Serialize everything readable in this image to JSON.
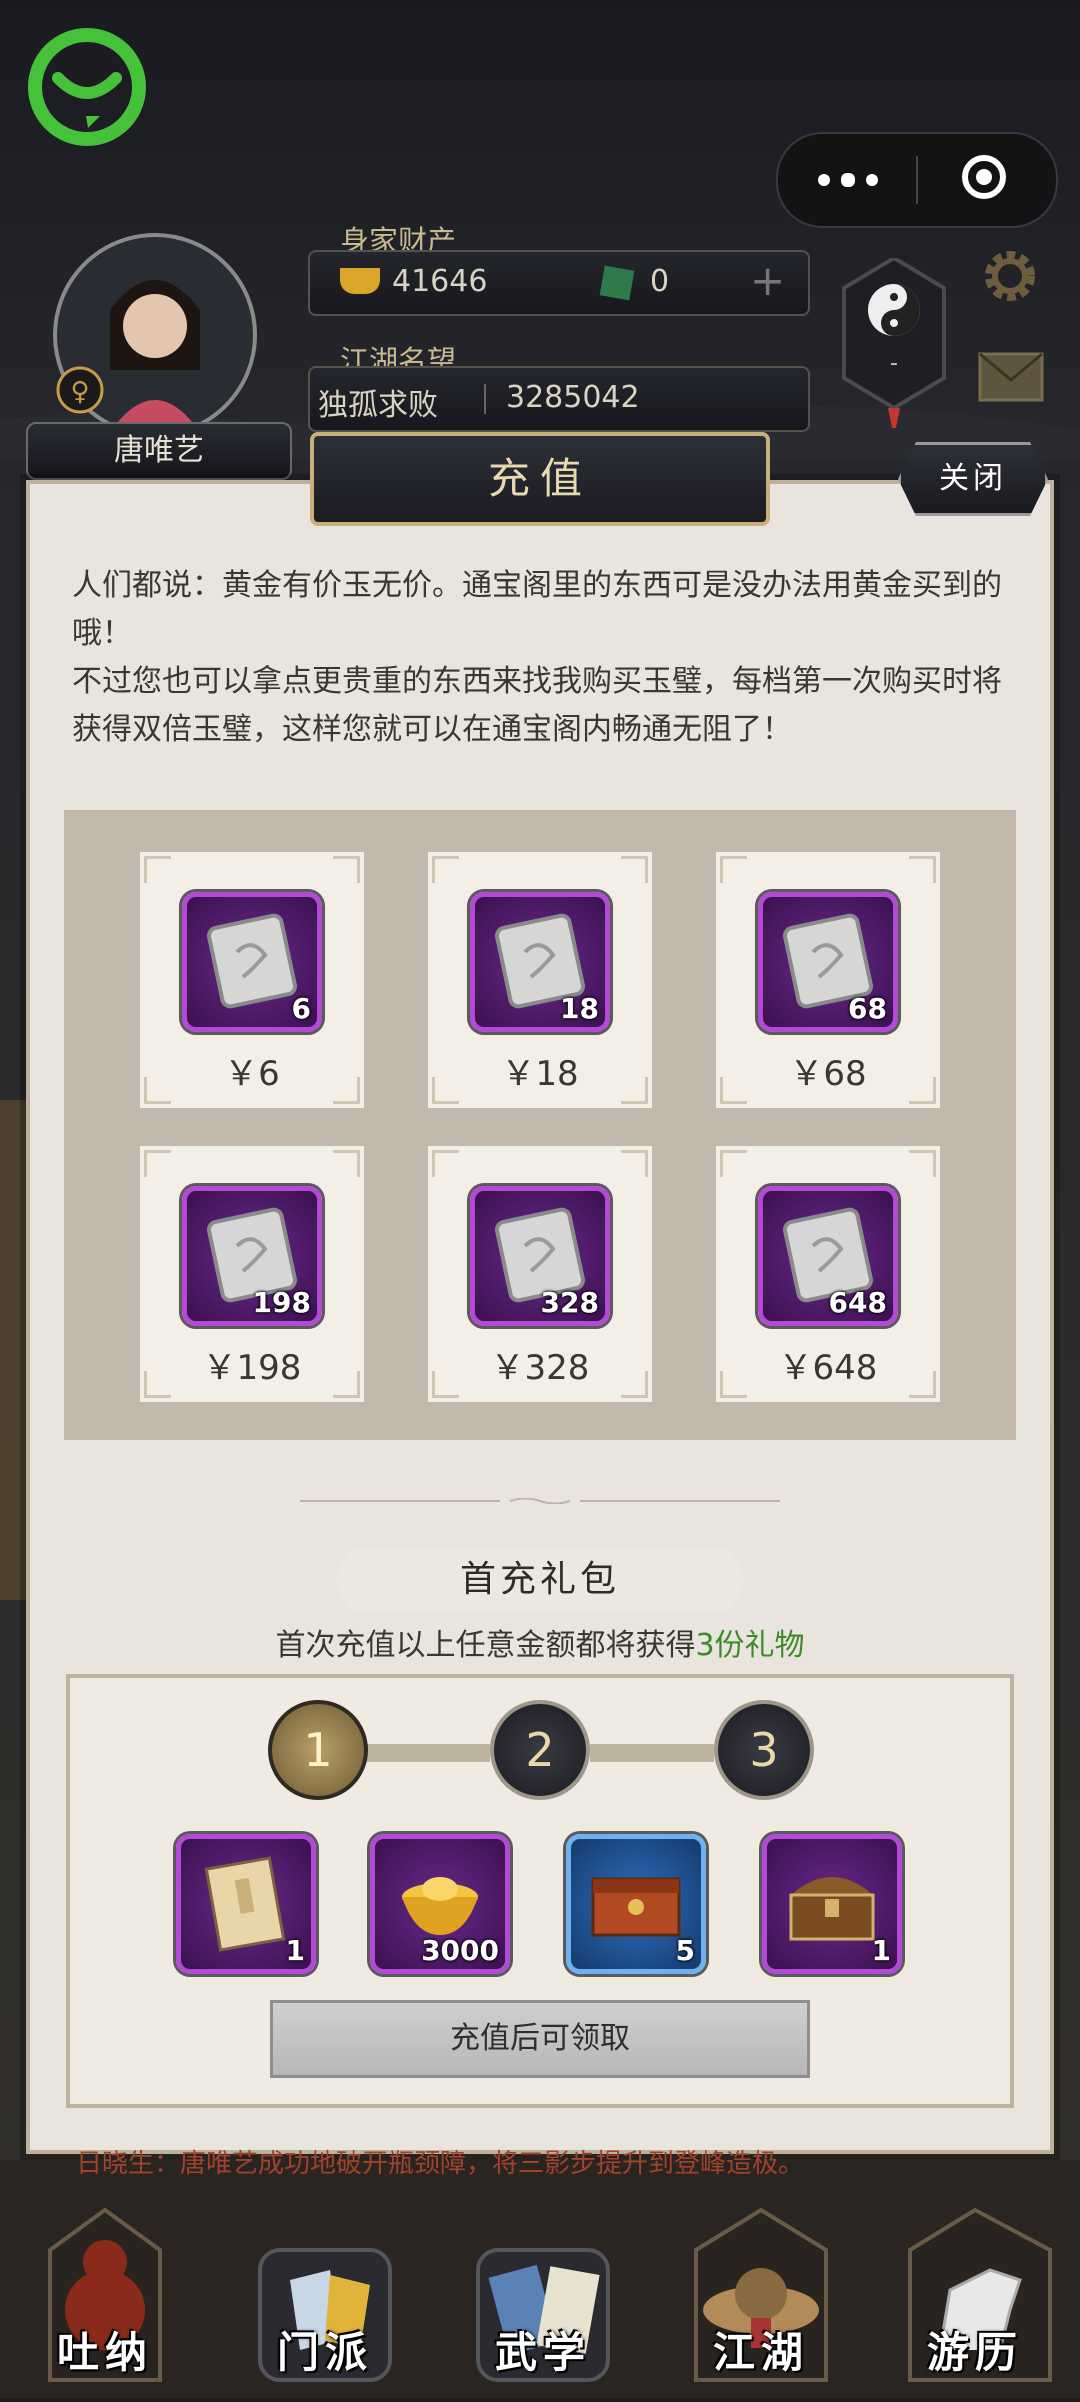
{
  "header": {
    "wealth_label": "身家财产",
    "gold": "41646",
    "jade": "0",
    "fame_label": "江湖名望",
    "title": "独孤求败",
    "fame_value": "3285042",
    "player_name": "唐唯艺",
    "taiji_value": "-"
  },
  "dialog": {
    "title": "充值",
    "close_label": "关闭",
    "intro": "人们都说：黄金有价玉无价。通宝阁里的东西可是没办法用黄金买到的哦！\n不过您也可以拿点更贵重的东西来找我购买玉璧，每档第一次购买时将获得双倍玉璧，这样您就可以在通宝阁内畅通无阻了！",
    "packs": [
      {
        "qty": "6",
        "price": "￥6"
      },
      {
        "qty": "18",
        "price": "￥18"
      },
      {
        "qty": "68",
        "price": "￥68"
      },
      {
        "qty": "198",
        "price": "￥198"
      },
      {
        "qty": "328",
        "price": "￥328"
      },
      {
        "qty": "648",
        "price": "￥648"
      }
    ],
    "gift": {
      "title": "首充礼包",
      "subtitle_prefix": "首次充值以上任意金额都将获得",
      "subtitle_highlight": "3份礼物",
      "steps": [
        "1",
        "2",
        "3"
      ],
      "items": [
        {
          "icon": "book-icon",
          "qty": "1"
        },
        {
          "icon": "gold-ingot-icon",
          "qty": "3000"
        },
        {
          "icon": "red-chest-icon",
          "qty": "5"
        },
        {
          "icon": "treasure-chest-icon",
          "qty": "1"
        }
      ],
      "claim_label": "充值后可领取"
    }
  },
  "ticker": "日晓生：唐唯艺成功地破开瓶颈障，将三影步提升到登峰造极。",
  "nav": [
    "吐纳",
    "门派",
    "武学",
    "江湖",
    "游历"
  ],
  "colors": {
    "accent_green": "#3e8a2a",
    "purple_frame": "#b34ad6",
    "gold_frame": "#c9b07a"
  }
}
